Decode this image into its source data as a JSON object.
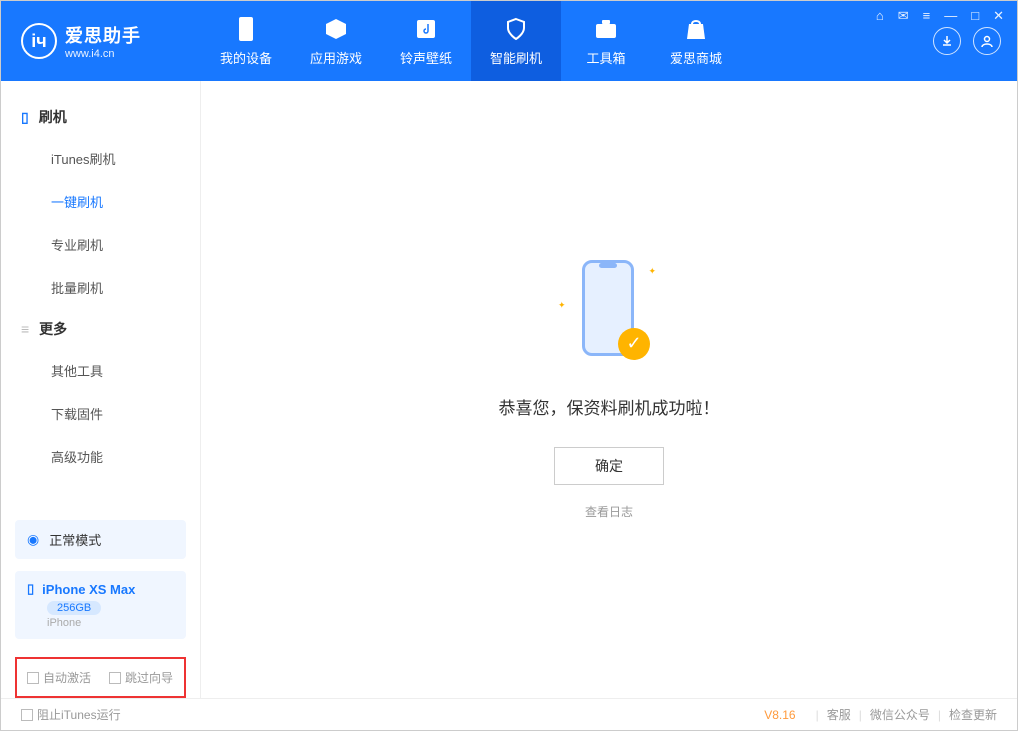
{
  "app": {
    "title": "爱思助手",
    "subtitle": "www.i4.cn"
  },
  "nav": {
    "tabs": [
      {
        "label": "我的设备"
      },
      {
        "label": "应用游戏"
      },
      {
        "label": "铃声壁纸"
      },
      {
        "label": "智能刷机"
      },
      {
        "label": "工具箱"
      },
      {
        "label": "爱思商城"
      }
    ]
  },
  "sidebar": {
    "section1_title": "刷机",
    "section1_items": [
      {
        "label": "iTunes刷机"
      },
      {
        "label": "一键刷机"
      },
      {
        "label": "专业刷机"
      },
      {
        "label": "批量刷机"
      }
    ],
    "section2_title": "更多",
    "section2_items": [
      {
        "label": "其他工具"
      },
      {
        "label": "下载固件"
      },
      {
        "label": "高级功能"
      }
    ],
    "mode_label": "正常模式",
    "device_name": "iPhone XS Max",
    "device_capacity": "256GB",
    "device_type": "iPhone",
    "checkbox1": "自动激活",
    "checkbox2": "跳过向导"
  },
  "main": {
    "success_message": "恭喜您，保资料刷机成功啦！",
    "ok_button": "确定",
    "view_log": "查看日志"
  },
  "footer": {
    "block_itunes": "阻止iTunes运行",
    "version": "V8.16",
    "links": [
      {
        "label": "客服"
      },
      {
        "label": "微信公众号"
      },
      {
        "label": "检查更新"
      }
    ]
  }
}
